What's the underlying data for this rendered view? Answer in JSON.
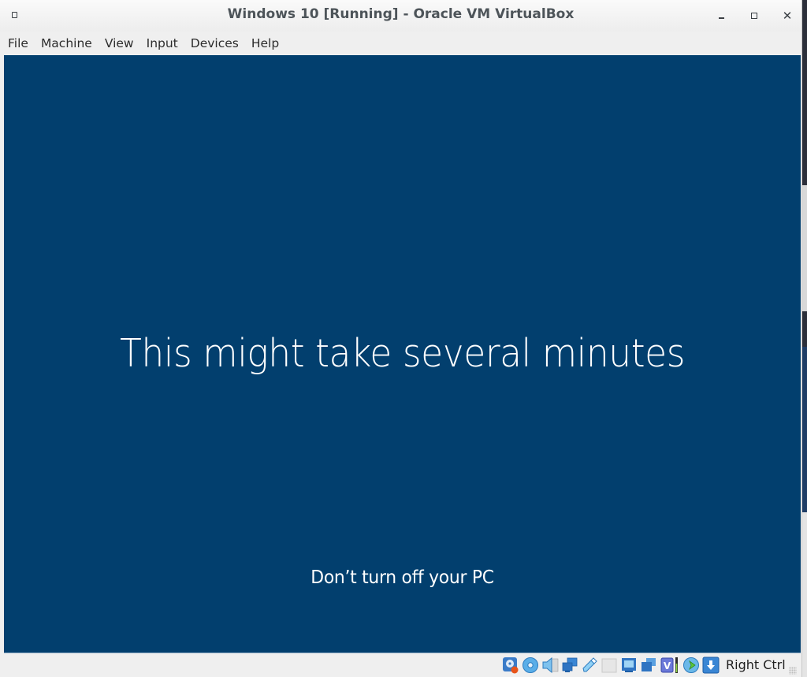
{
  "window": {
    "title": "Windows 10 [Running] - Oracle VM VirtualBox",
    "controls": {
      "minimize": "minimize",
      "maximize": "maximize",
      "close": "✕"
    }
  },
  "menubar": {
    "items": [
      {
        "label": "File"
      },
      {
        "label": "Machine"
      },
      {
        "label": "View"
      },
      {
        "label": "Input"
      },
      {
        "label": "Devices"
      },
      {
        "label": "Help"
      }
    ]
  },
  "vm_screen": {
    "background": "#023f6e",
    "main_message": "This might take several minutes",
    "sub_message": "Don’t turn off your PC"
  },
  "statusbar": {
    "indicators": [
      {
        "name": "hard-disk-icon",
        "meaning": "Hard disk activity"
      },
      {
        "name": "optical-drive-icon",
        "meaning": "Optical drive"
      },
      {
        "name": "audio-icon",
        "meaning": "Audio"
      },
      {
        "name": "network-icon",
        "meaning": "Network"
      },
      {
        "name": "usb-icon",
        "meaning": "USB"
      },
      {
        "name": "shared-folders-icon",
        "meaning": "Shared folders"
      },
      {
        "name": "display-icon",
        "meaning": "Display"
      },
      {
        "name": "video-capture-icon",
        "meaning": "Recording"
      },
      {
        "name": "vt-x-icon",
        "meaning": "Hardware virtualization",
        "glyph": "V"
      },
      {
        "name": "mouse-integration-icon",
        "meaning": "Mouse integration"
      },
      {
        "name": "keyboard-capture-icon",
        "meaning": "Keyboard capture"
      }
    ],
    "host_key": "Right Ctrl"
  }
}
